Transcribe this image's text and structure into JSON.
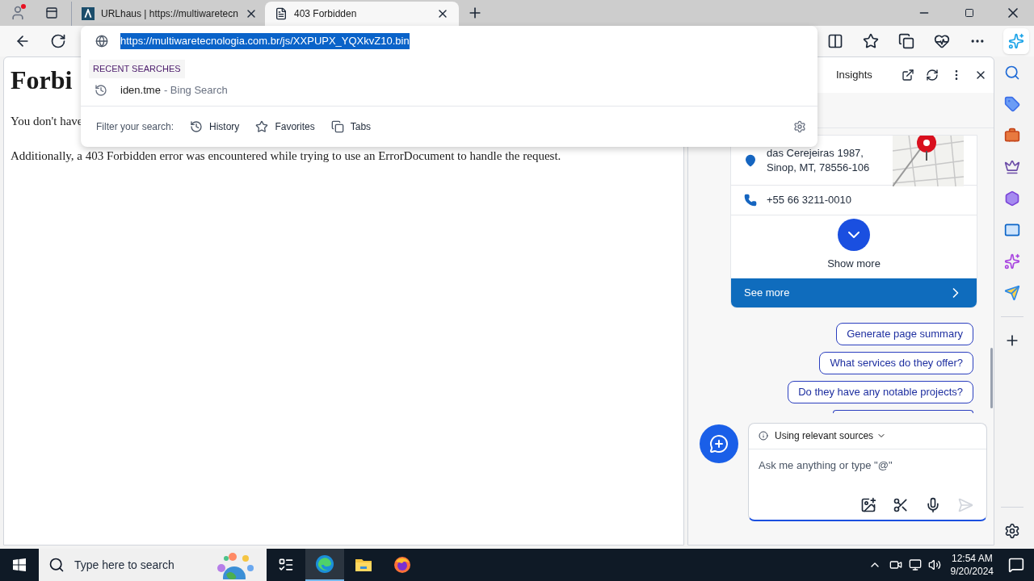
{
  "browser": {
    "tabs": [
      {
        "title": "URLhaus | https://multiwaretecn",
        "selected": false
      },
      {
        "title": "403 Forbidden",
        "selected": true
      }
    ]
  },
  "address_dropdown": {
    "url": "https://multiwaretecnologia.com.br/js/XXPUPX_YQXkvZ10.bin",
    "section": "RECENT SEARCHES",
    "recent": [
      {
        "query": "iden.tme",
        "source": "- Bing Search"
      }
    ],
    "filter_label": "Filter your search:",
    "filters": [
      {
        "kind": "history",
        "label": "History"
      },
      {
        "kind": "favorites",
        "label": "Favorites"
      },
      {
        "kind": "tabs",
        "label": "Tabs"
      }
    ]
  },
  "page": {
    "heading": "Forbi",
    "paragraphs": [
      "You don't have",
      "Additionally, a 403 Forbidden error was encountered while trying to use an ErrorDocument to handle the request."
    ]
  },
  "copilot": {
    "title": "Insights",
    "address_lines": [
      "das Cerejeiras 1987,",
      "Sinop, MT, 78556-106"
    ],
    "phone": "+55 66 3211-0010",
    "show_more": "Show more",
    "see_more": "See more",
    "suggestions": [
      "Generate page summary",
      "What services do they offer?",
      "Do they have any notable projects?"
    ],
    "sources": "Using relevant sources",
    "input_placeholder": "Ask me anything or type \"@\""
  },
  "taskbar": {
    "search_placeholder": "Type here to search",
    "apps": [
      {
        "kind": "taskview",
        "selected": false
      },
      {
        "kind": "edge",
        "selected": true
      },
      {
        "kind": "explorer",
        "selected": false
      },
      {
        "kind": "firefox",
        "selected": false
      }
    ],
    "time": "12:54 AM",
    "date": "9/20/2024"
  }
}
